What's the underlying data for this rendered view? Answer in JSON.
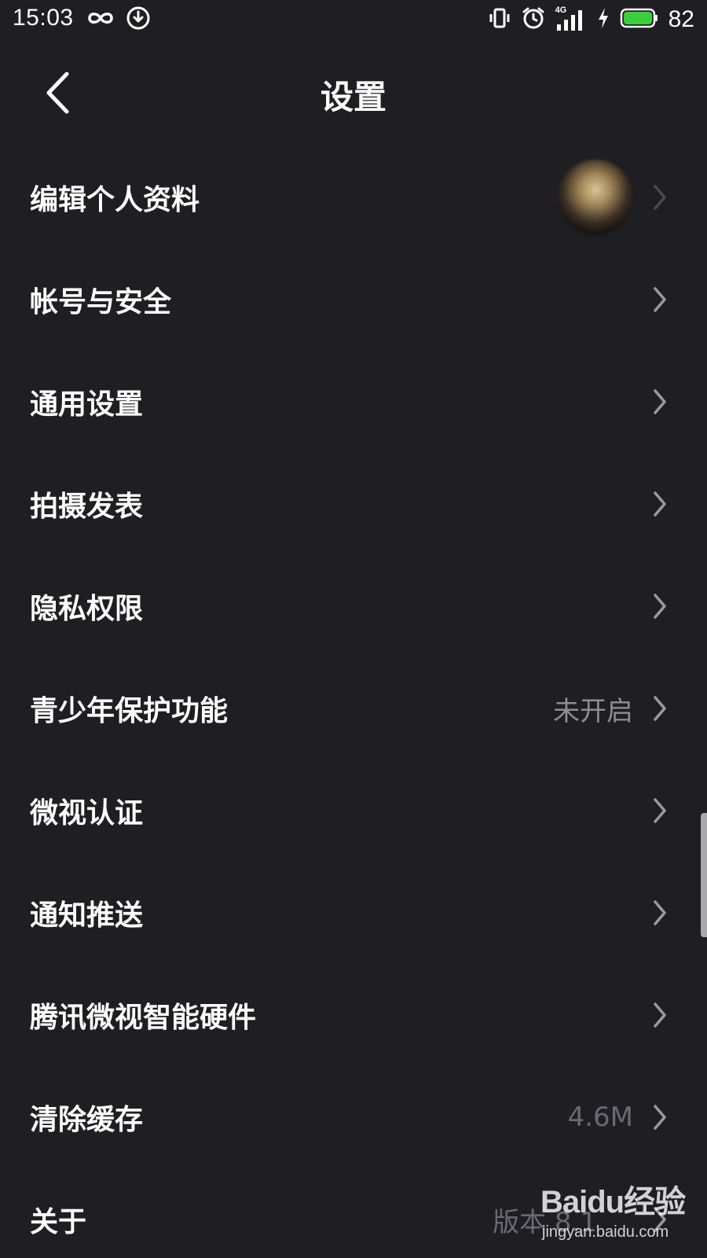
{
  "status_bar": {
    "time": "15:03",
    "network": "4G",
    "battery_percent": "82",
    "battery_color": "#3ccf3c",
    "left_icons": [
      "infinity-icon",
      "download-icon"
    ],
    "right_icons": [
      "vibrate-icon",
      "alarm-icon",
      "signal-icon",
      "charging-icon",
      "battery-icon"
    ]
  },
  "nav": {
    "title": "设置",
    "back_icon": "chevron-left-icon"
  },
  "settings": {
    "items": [
      {
        "label": "编辑个人资料",
        "value": "",
        "has_avatar": true
      },
      {
        "label": "帐号与安全",
        "value": ""
      },
      {
        "label": "通用设置",
        "value": ""
      },
      {
        "label": "拍摄发表",
        "value": ""
      },
      {
        "label": "隐私权限",
        "value": ""
      },
      {
        "label": "青少年保护功能",
        "value": "未开启"
      },
      {
        "label": "微视认证",
        "value": ""
      },
      {
        "label": "通知推送",
        "value": ""
      },
      {
        "label": "腾讯微视智能硬件",
        "value": ""
      },
      {
        "label": "清除缓存",
        "value": "4.6M"
      },
      {
        "label": "关于",
        "value": "版本 8.1"
      }
    ]
  },
  "watermark": {
    "brand": "Baidu经验",
    "url": "jingyan.baidu.com"
  },
  "colors": {
    "background": "#1f1e23",
    "primary_text": "#ffffff",
    "secondary_text": "#8e8d92",
    "chevron": "#9a999e"
  }
}
